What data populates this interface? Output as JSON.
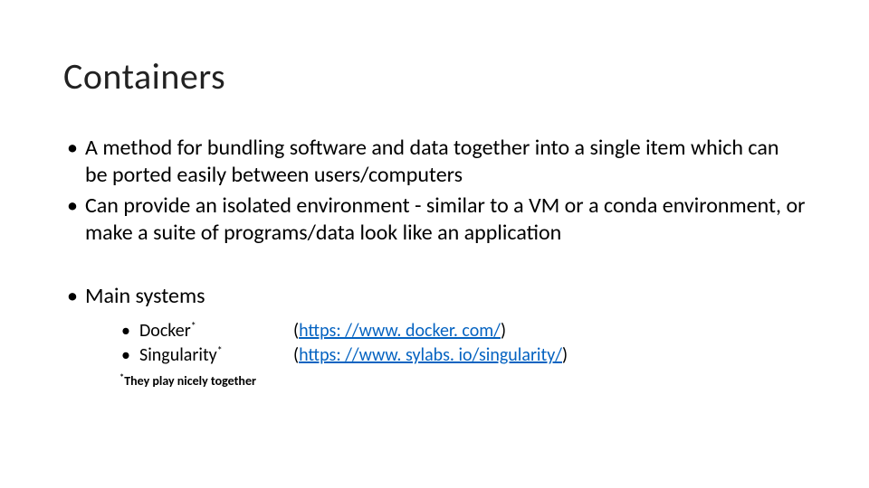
{
  "title": "Containers",
  "bullets": {
    "b1": "A method for bundling software and data together into a single item which can be ported easily between users/computers",
    "b2": "Can provide an isolated environment - similar to a VM or a conda environment, or make a suite of programs/data look like an application",
    "b3": "Main systems"
  },
  "systems": {
    "docker": {
      "name": "Docker",
      "sup": "*",
      "url": "https: //www. docker. com/"
    },
    "singularity": {
      "name": "Singularity",
      "sup": "*",
      "url": "https: //www. sylabs. io/singularity/"
    }
  },
  "footnote": {
    "sup": "*",
    "text": "They play nicely together"
  },
  "parens": {
    "open": "(",
    "close": ")"
  }
}
